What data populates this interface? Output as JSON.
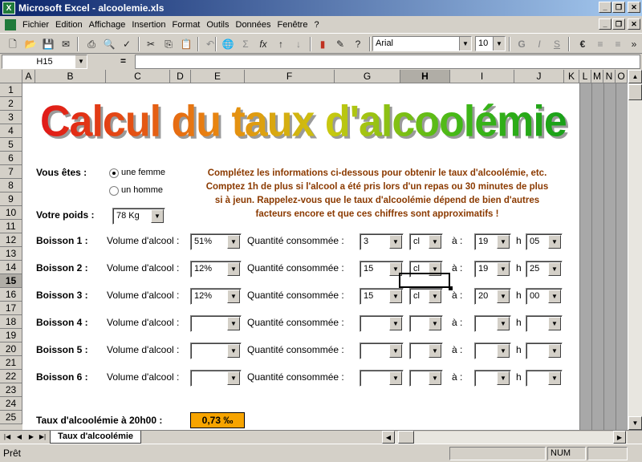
{
  "window": {
    "title": "Microsoft Excel - alcoolemie.xls",
    "app_icon": "excel-icon"
  },
  "menu": [
    "Fichier",
    "Edition",
    "Affichage",
    "Insertion",
    "Format",
    "Outils",
    "Données",
    "Fenêtre",
    "?"
  ],
  "toolbar": {
    "font": "Arial",
    "size": "10",
    "bold": "G",
    "italic": "I",
    "underline": "S",
    "currency": "€"
  },
  "formula_bar": {
    "cell_ref": "H15",
    "equals": "=",
    "content": ""
  },
  "columns": [
    "A",
    "B",
    "C",
    "D",
    "E",
    "F",
    "G",
    "H",
    "I",
    "J",
    "K",
    "L",
    "M",
    "N",
    "O",
    "P"
  ],
  "rows": [
    "1",
    "2",
    "3",
    "4",
    "5",
    "6",
    "7",
    "8",
    "9",
    "10",
    "11",
    "12",
    "13",
    "14",
    "15",
    "16",
    "17",
    "18",
    "19",
    "20",
    "21",
    "22",
    "23",
    "24",
    "25"
  ],
  "selected": {
    "column": "H",
    "row": "15"
  },
  "sheet": {
    "title": "Calcul du taux d'alcoolémie",
    "vous_etes_label": "Vous êtes :",
    "gender_options": [
      "une femme",
      "un homme"
    ],
    "gender_selected": "une femme",
    "poids_label": "Votre poids :",
    "poids_value": "78 Kg",
    "info_lines": [
      "Complétez les informations ci-dessous pour obtenir le taux d'alcoolémie, etc.",
      "Comptez 1h de plus si l'alcool a été pris lors d'un repas ou 30 minutes de plus",
      "si à jeun. Rappelez-vous que le taux d'alcoolémie dépend de bien d'autres",
      "facteurs encore et que ces chiffres sont approximatifs !"
    ],
    "volume_label": "Volume d'alcool :",
    "quantite_label": "Quantité consommée :",
    "a_label": "à :",
    "h_label": "h",
    "drinks": [
      {
        "label": "Boisson 1 :",
        "volume": "51%",
        "quantite": "3",
        "unite": "cl",
        "heure": "19",
        "minute": "05"
      },
      {
        "label": "Boisson 2 :",
        "volume": "12%",
        "quantite": "15",
        "unite": "cl",
        "heure": "19",
        "minute": "25"
      },
      {
        "label": "Boisson 3 :",
        "volume": "12%",
        "quantite": "15",
        "unite": "cl",
        "heure": "20",
        "minute": "00"
      },
      {
        "label": "Boisson 4 :",
        "volume": "",
        "quantite": "",
        "unite": "",
        "heure": "",
        "minute": ""
      },
      {
        "label": "Boisson 5 :",
        "volume": "",
        "quantite": "",
        "unite": "",
        "heure": "",
        "minute": ""
      },
      {
        "label": "Boisson 6 :",
        "volume": "",
        "quantite": "",
        "unite": "",
        "heure": "",
        "minute": ""
      }
    ],
    "result_label": "Taux d'alcoolémie à 20h00 :",
    "result_value": "0,73 ‰"
  },
  "sheet_tab": "Taux d'alcoolémie",
  "status": {
    "text": "Prêt",
    "num": "NUM"
  }
}
